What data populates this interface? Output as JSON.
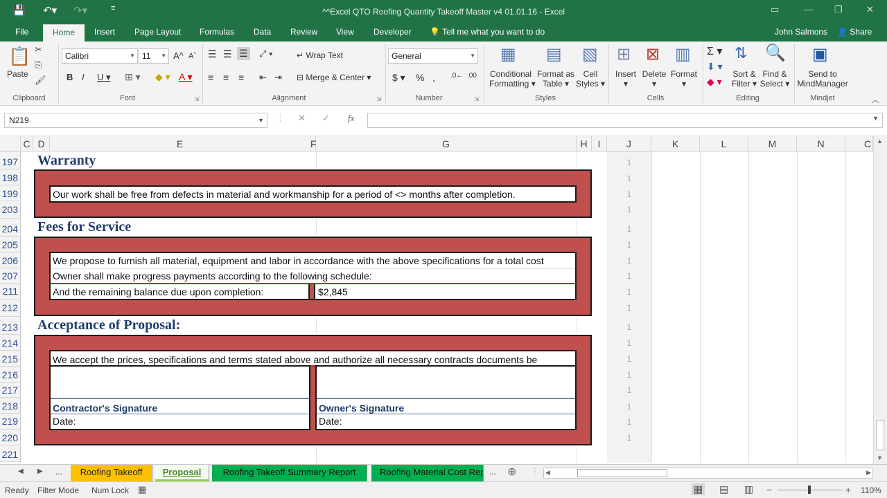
{
  "titlebar": {
    "title": "^^Excel QTO Roofing Quantity Takeoff Master v4 01.01.16  -  Excel"
  },
  "tabs": [
    "File",
    "Home",
    "Insert",
    "Page Layout",
    "Formulas",
    "Data",
    "Review",
    "View",
    "Developer"
  ],
  "tellme": "Tell me what you want to do",
  "user": "John Salmons",
  "share": "Share",
  "ribbon": {
    "paste": "Paste",
    "clipboard": "Clipboard",
    "font_name": "Calibri",
    "font_size": "11",
    "font": "Font",
    "wrap_text": "Wrap Text",
    "merge_center": "Merge & Center",
    "alignment": "Alignment",
    "number_format": "General",
    "number": "Number",
    "cond_format_1": "Conditional",
    "cond_format_2": "Formatting",
    "format_table_1": "Format as",
    "format_table_2": "Table",
    "cell_styles_1": "Cell",
    "cell_styles_2": "Styles",
    "styles": "Styles",
    "insert": "Insert",
    "delete": "Delete",
    "format": "Format",
    "cells": "Cells",
    "sort_1": "Sort &",
    "sort_2": "Filter",
    "find_1": "Find &",
    "find_2": "Select",
    "editing": "Editing",
    "send_1": "Send to",
    "send_2": "MindManager",
    "mindjet": "Mindjet"
  },
  "namebox": "N219",
  "columns": [
    "C",
    "D",
    "E",
    "F",
    "G",
    "H",
    "I",
    "J",
    "K",
    "L",
    "M",
    "N",
    "C"
  ],
  "rows": [
    "197",
    "198",
    "199",
    "203",
    "204",
    "205",
    "206",
    "207",
    "211",
    "212",
    "213",
    "214",
    "215",
    "216",
    "217",
    "218",
    "219",
    "220",
    "221"
  ],
  "j_values": [
    "1",
    "1",
    "1",
    "1",
    "1",
    "1",
    "1",
    "1",
    "1",
    "1",
    "1",
    "1",
    "1",
    "1",
    "1",
    "1",
    "1",
    "1"
  ],
  "sections": {
    "warranty": "Warranty",
    "warranty_text": "Our work shall be free from defects in material and workmanship for a period of <> months after completion.",
    "fees": "Fees for Service",
    "fees_line1": "We propose to furnish all material, equipment and labor in accordance with the above specifications for a total cost",
    "fees_line2": "Owner shall make progress payments according to the following schedule:",
    "fees_line3": "And the remaining balance due upon completion:",
    "fees_amount": "$2,845",
    "acceptance": "Acceptance of Proposal:",
    "acceptance_text": "We accept the prices, specifications and terms stated above and authorize all necessary contracts documents be",
    "contractor_sig": "Contractor's Signature",
    "owner_sig": "Owner's Signature",
    "date_label": "Date:"
  },
  "sheets": [
    {
      "name": "Roofing Takeoff",
      "color": "#ffc000"
    },
    {
      "name": "Proposal",
      "color": "#92d050"
    },
    {
      "name": "Roofing Takeoff Summary Report",
      "color": "#00b050"
    },
    {
      "name": "Roofing Material Cost Rep",
      "color": "#00b050"
    }
  ],
  "sheet_nav_more": "...",
  "status": {
    "ready": "Ready",
    "filter": "Filter Mode",
    "numlock": "Num Lock",
    "zoom": "110%"
  }
}
